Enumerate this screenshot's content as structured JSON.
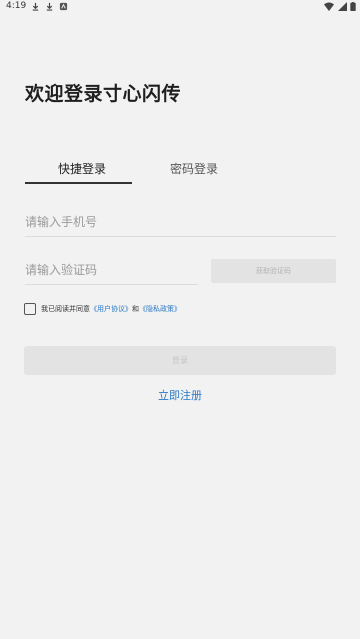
{
  "status_bar": {
    "time": "4:19",
    "icons": [
      "download-icon",
      "download-icon",
      "app-notification-icon",
      "wifi-icon",
      "signal-icon",
      "battery-icon"
    ]
  },
  "page": {
    "title": "欢迎登录寸心闪传"
  },
  "tabs": [
    {
      "label": "快捷登录",
      "active": true
    },
    {
      "label": "密码登录",
      "active": false
    }
  ],
  "form": {
    "phone_placeholder": "请输入手机号",
    "phone_value": "",
    "code_placeholder": "请输入验证码",
    "code_value": "",
    "get_code_label": "获取验证码",
    "agreement": {
      "checked": false,
      "prefix": "我已阅读并同意",
      "user_agreement": "《用户协议》",
      "conjunction": "和",
      "privacy_policy": "《隐私政策》"
    },
    "login_label": "登录",
    "register_label": "立即注册"
  },
  "colors": {
    "background": "#f2f2f2",
    "link": "#2a78c4",
    "disabled_button": "#e3e3e3"
  }
}
